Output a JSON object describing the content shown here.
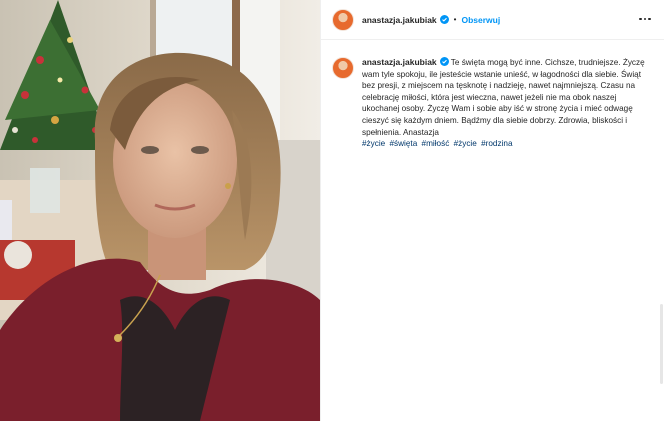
{
  "post": {
    "username": "anastazja.jakubiak",
    "separator": "•",
    "follow_label": "Obserwuj",
    "caption_text": "Te święta mogą być inne. Cichsze, trudniejsze. Życzę wam tyle spokoju, ile jesteście wstanie unieść, w łagodności dla siebie. Świąt bez presji, z miejscem na tęsknotę i nadzieję, nawet najmniejszą. Czasu na celebrację miłości, która jest wieczna, nawet jeżeli nie ma obok naszej ukochanej osoby. Życzę Wam i sobie aby iść w stronę życia i mieć odwagę cieszyć się każdym dniem. Bądźmy dla siebie dobrzy. Zdrowia, bliskości i spełnienia. Anastazja",
    "hashtags": [
      "#życie",
      "#święta",
      "#miłość",
      "#życie",
      "#rodzina"
    ]
  },
  "colors": {
    "link_blue": "#0095f6",
    "hashtag_blue": "#00376b",
    "verified_blue": "#0095f6",
    "sweater": "#7a1f2c"
  },
  "icons": {
    "verified": "verified-badge-icon",
    "more": "more-options-icon"
  }
}
